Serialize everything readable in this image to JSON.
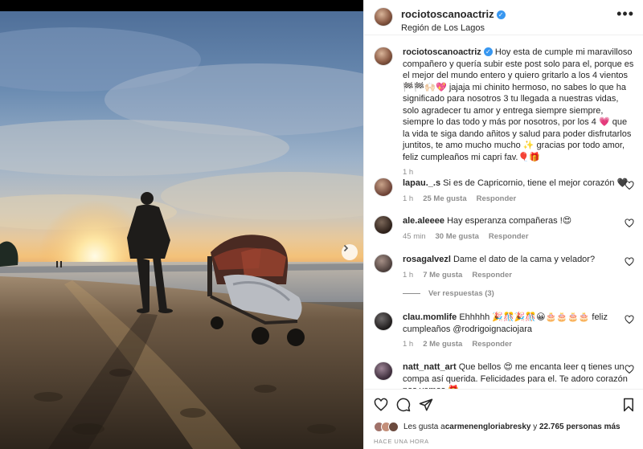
{
  "post": {
    "username": "rociotoscanoactriz",
    "location": "Región de Los Lagos",
    "caption": "Hoy esta de cumple mi maravilloso compañero y quería subir este post solo para el, porque es el mejor del mundo entero y quiero gritarlo a los 4 vientos 🏁🏁🙌🏻💖 jajaja mi chinito hermoso, no sabes lo que ha significado para nosotros 3 tu llegada a nuestras vidas, solo agradecer tu amor y entrega siempre siempre, siempre lo das todo y más por nosotros, por los 4 💗 que la vida te siga dando añitos y salud para poder disfrutarlos juntitos, te amo mucho mucho ✨ gracias por todo amor, feliz cumpleaños mi capri fav.🎈🎁",
    "caption_time": "1 h"
  },
  "comments": [
    {
      "username": "lapau._.s",
      "text": "Si es de Capricornio, tiene el mejor corazón 🖤",
      "time": "1 h",
      "likes": "25 Me gusta",
      "reply": "Responder"
    },
    {
      "username": "ale.aleeee",
      "text": "Hay esperanza compañeras !😍",
      "time": "45 min",
      "likes": "30 Me gusta",
      "reply": "Responder"
    },
    {
      "username": "rosagalvezl",
      "text": "Dame el dato de la cama y velador?",
      "time": "1 h",
      "likes": "7 Me gusta",
      "reply": "Responder",
      "view_replies": "Ver respuestas (3)"
    },
    {
      "username": "clau.momlife",
      "text": "Ehhhhh 🎉🎊🎉🎊😀🎂🎂🎂🎂 feliz cumpleaños @rodrigoignaciojara",
      "time": "1 h",
      "likes": "2 Me gusta",
      "reply": "Responder"
    },
    {
      "username": "natt_natt_art",
      "text": "Que bellos 😍 me encanta leer q tienes un compa así querida. Felicidades para el. Te adoro corazón nos vemos 🎁",
      "time": "",
      "likes": "",
      "reply": ""
    }
  ],
  "footer": {
    "likes_prefix": "Les gusta a ",
    "likes_user": "carmenengloriabresky",
    "likes_middle": " y ",
    "likes_count": "22.765 personas más",
    "timestamp": "HACE UNA HORA"
  },
  "icons": {
    "verified": "verified-badge-icon",
    "more": "more-options-icon",
    "heart": "heart-icon",
    "comment": "comment-icon",
    "share": "share-icon",
    "save": "bookmark-icon",
    "next": "chevron-right-icon"
  },
  "colors": {
    "verified": "#3897f0",
    "muted": "#8e8e8e",
    "text": "#262626"
  }
}
